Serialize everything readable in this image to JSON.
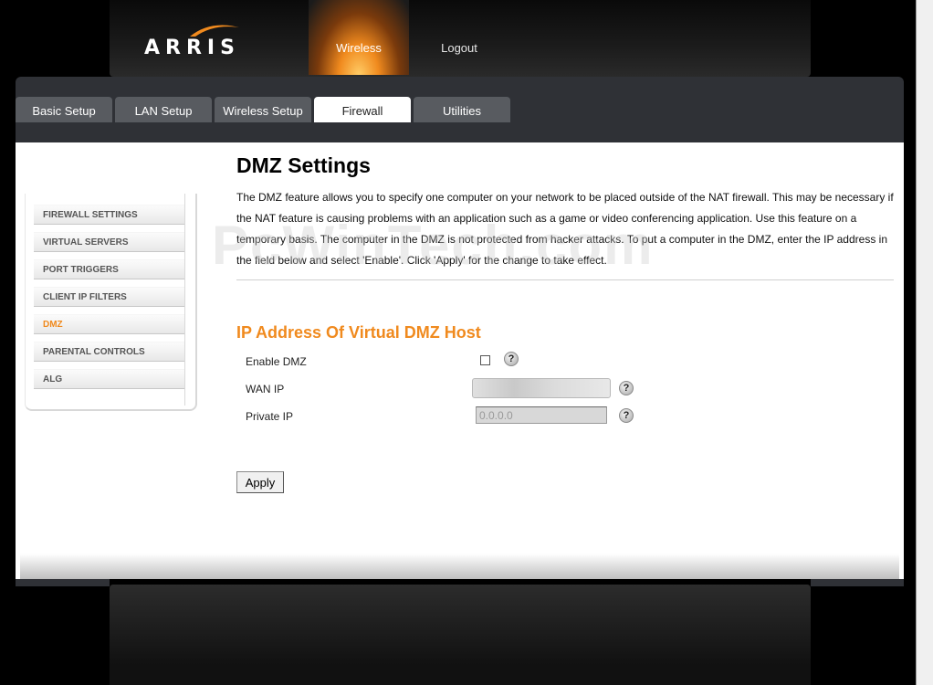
{
  "brand": {
    "logo_text": "ARRIS"
  },
  "top_nav": {
    "items": [
      "Wireless",
      "Logout"
    ],
    "active": "Wireless"
  },
  "tabs": [
    "Basic Setup",
    "LAN Setup",
    "Wireless Setup",
    "Firewall",
    "Utilities"
  ],
  "active_tab": "Firewall",
  "side_menu": {
    "items": [
      "FIREWALL SETTINGS",
      "VIRTUAL SERVERS",
      "PORT TRIGGERS",
      "CLIENT IP FILTERS",
      "DMZ",
      "PARENTAL CONTROLS",
      "ALG"
    ],
    "active": "DMZ"
  },
  "page": {
    "title": "DMZ Settings",
    "description": "The DMZ feature allows you to specify one computer on your network to be placed outside of the NAT firewall. This may be necessary if the NAT feature is causing problems with an application such as a game or video conferencing application. Use this feature on a temporary basis. The computer in the DMZ is not protected from hacker attacks. To put a computer in the DMZ, enter the IP address in the field below and select 'Enable'. Click 'Apply' for the change to take effect.",
    "watermark": "PcWinTech.com",
    "section_title": "IP Address Of Virtual DMZ Host"
  },
  "form": {
    "enable_dmz_label": "Enable DMZ",
    "enable_dmz_checked": false,
    "wan_ip_label": "WAN IP",
    "private_ip_label": "Private IP",
    "private_ip_value": "0.0.0.0",
    "help_glyph": "?",
    "apply_label": "Apply"
  },
  "colors": {
    "accent": "#f08a1e",
    "tab_bg": "#585b60",
    "band_bg": "#2f3136"
  },
  "icons": {
    "help": "question-circle-icon",
    "logo_swoosh": "arris-swoosh-icon"
  }
}
